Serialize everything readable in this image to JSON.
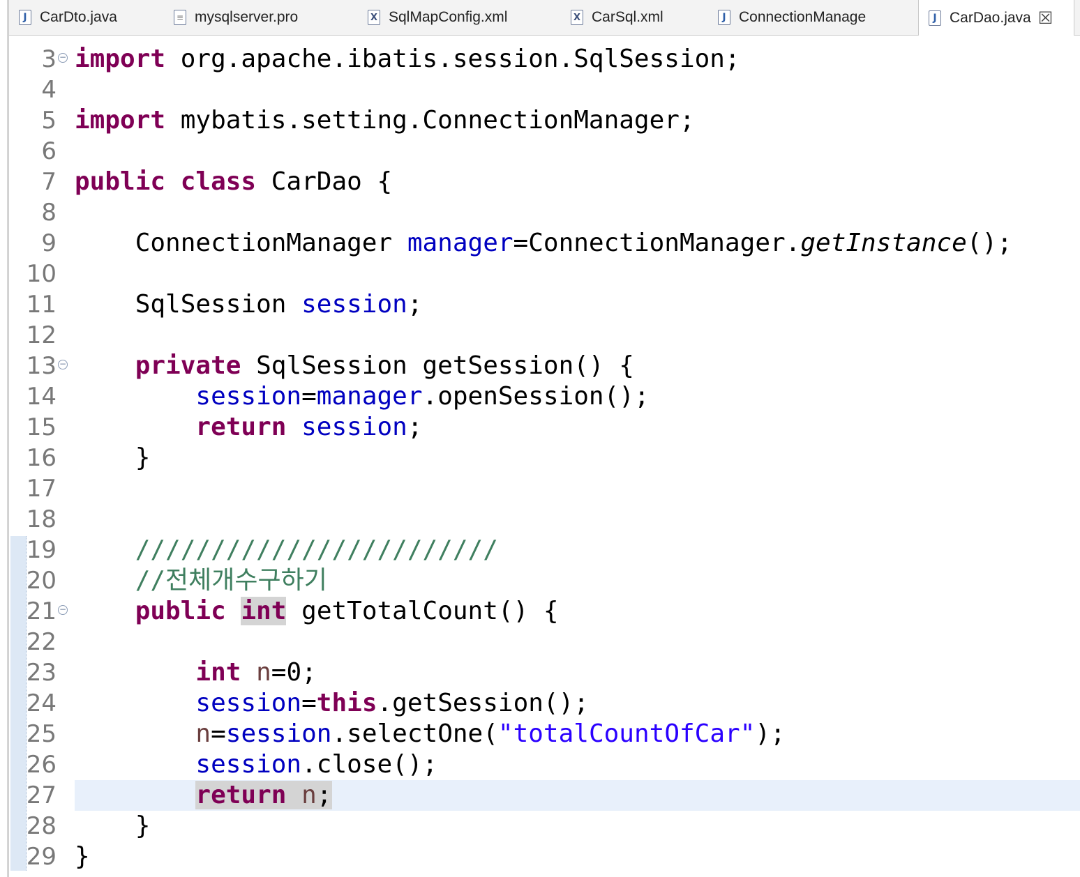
{
  "tabs": [
    {
      "label": "CarDto.java",
      "icon": "java-file-icon"
    },
    {
      "label": "mysqlserver.pro",
      "icon": "text-file-icon"
    },
    {
      "label": "SqlMapConfig.xml",
      "icon": "xml-file-icon"
    },
    {
      "label": "CarSql.xml",
      "icon": "xml-file-icon"
    },
    {
      "label": "ConnectionManage",
      "icon": "java-file-icon"
    },
    {
      "label": "CarDao.java",
      "icon": "java-file-icon",
      "active": true
    }
  ],
  "editor": {
    "lines": [
      {
        "num": "3",
        "tokens": [
          [
            "import",
            "kw"
          ],
          [
            " org.apache.ibatis.session.SqlSession;",
            ""
          ]
        ]
      },
      {
        "num": "4",
        "tokens": []
      },
      {
        "num": "5",
        "tokens": [
          [
            "import",
            "kw"
          ],
          [
            " mybatis.setting.ConnectionManager;",
            ""
          ]
        ]
      },
      {
        "num": "6",
        "tokens": []
      },
      {
        "num": "7",
        "tokens": [
          [
            "public",
            "kw"
          ],
          [
            " ",
            ""
          ],
          [
            "class",
            "kw"
          ],
          [
            " CarDao {",
            ""
          ]
        ]
      },
      {
        "num": "8",
        "tokens": []
      },
      {
        "num": "9",
        "tokens": [
          [
            "    ConnectionManager ",
            ""
          ],
          [
            "manager",
            "fld"
          ],
          [
            "=ConnectionManager.",
            ""
          ],
          [
            "getInstance",
            "it"
          ],
          [
            "();",
            ""
          ]
        ]
      },
      {
        "num": "10",
        "tokens": []
      },
      {
        "num": "11",
        "tokens": [
          [
            "    SqlSession ",
            ""
          ],
          [
            "session",
            "fld"
          ],
          [
            ";",
            ""
          ]
        ]
      },
      {
        "num": "12",
        "tokens": []
      },
      {
        "num": "13",
        "tokens": [
          [
            "    ",
            ""
          ],
          [
            "private",
            "kw"
          ],
          [
            " SqlSession getSession() {",
            ""
          ]
        ]
      },
      {
        "num": "14",
        "tokens": [
          [
            "        ",
            ""
          ],
          [
            "session",
            "fld"
          ],
          [
            "=",
            ""
          ],
          [
            "manager",
            "fld"
          ],
          [
            ".openSession();",
            ""
          ]
        ]
      },
      {
        "num": "15",
        "tokens": [
          [
            "        ",
            ""
          ],
          [
            "return",
            "kw"
          ],
          [
            " ",
            ""
          ],
          [
            "session",
            "fld"
          ],
          [
            ";",
            ""
          ]
        ]
      },
      {
        "num": "16",
        "tokens": [
          [
            "    }",
            ""
          ]
        ]
      },
      {
        "num": "17",
        "tokens": []
      },
      {
        "num": "18",
        "tokens": []
      },
      {
        "num": "19",
        "tokens": [
          [
            "    ",
            ""
          ],
          [
            "////////////////////////",
            "cmt"
          ]
        ]
      },
      {
        "num": "20",
        "tokens": [
          [
            "    ",
            ""
          ],
          [
            "//전체개수구하기",
            "cmt"
          ]
        ]
      },
      {
        "num": "21",
        "tokens": [
          [
            "    ",
            ""
          ],
          [
            "public",
            "kw"
          ],
          [
            " ",
            ""
          ],
          [
            "int",
            "kw occ"
          ],
          [
            " getTotalCount() {",
            ""
          ]
        ]
      },
      {
        "num": "22",
        "tokens": []
      },
      {
        "num": "23",
        "tokens": [
          [
            "        ",
            ""
          ],
          [
            "int",
            "kw"
          ],
          [
            " ",
            ""
          ],
          [
            "n",
            "lv"
          ],
          [
            "=0;",
            ""
          ]
        ]
      },
      {
        "num": "24",
        "tokens": [
          [
            "        ",
            ""
          ],
          [
            "session",
            "fld"
          ],
          [
            "=",
            ""
          ],
          [
            "this",
            "kw"
          ],
          [
            ".getSession();",
            ""
          ]
        ]
      },
      {
        "num": "25",
        "tokens": [
          [
            "        ",
            ""
          ],
          [
            "n",
            "lv"
          ],
          [
            "=",
            ""
          ],
          [
            "session",
            "fld"
          ],
          [
            ".selectOne(",
            ""
          ],
          [
            "\"totalCountOfCar\"",
            "str"
          ],
          [
            ");",
            ""
          ]
        ]
      },
      {
        "num": "26",
        "tokens": [
          [
            "        ",
            ""
          ],
          [
            "session",
            "fld"
          ],
          [
            ".close();",
            ""
          ]
        ]
      },
      {
        "num": "27",
        "tokens": [
          [
            "        ",
            ""
          ],
          [
            "return",
            "kw occ"
          ],
          [
            " ",
            "occ"
          ],
          [
            "n",
            "lv occ"
          ],
          [
            ";",
            "occ"
          ]
        ]
      },
      {
        "num": "28",
        "tokens": [
          [
            "    }",
            ""
          ]
        ]
      },
      {
        "num": "29",
        "tokens": [
          [
            "}",
            ""
          ]
        ]
      }
    ]
  },
  "colors": {
    "keyword": "#7f0055",
    "field": "#0000c0",
    "string": "#2a00ff",
    "comment": "#3f7f5f",
    "current_line": "#e8f0fb"
  }
}
